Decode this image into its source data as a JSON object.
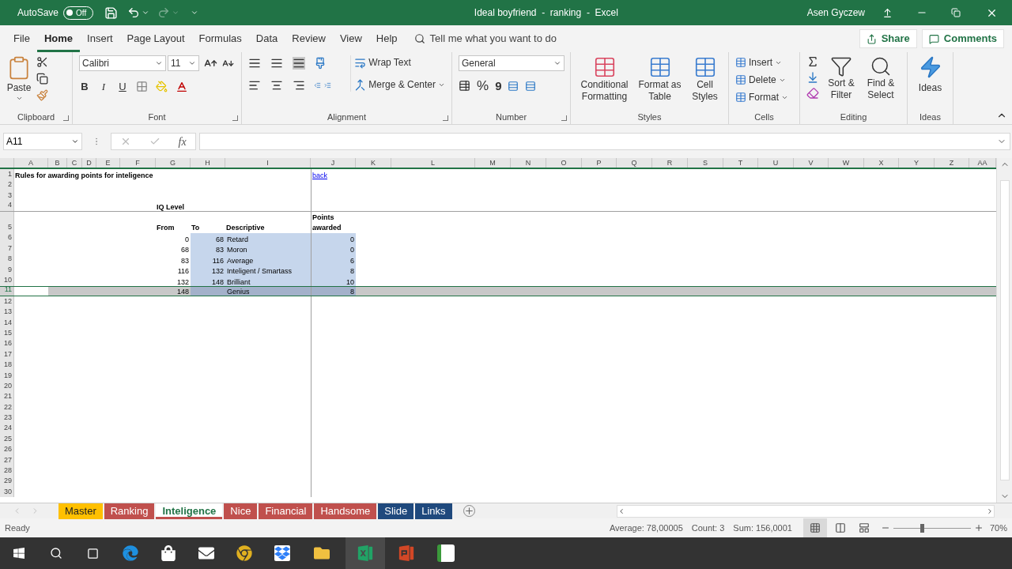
{
  "title_bar": {
    "autosave_label": "AutoSave",
    "autosave_state": "Off",
    "autosave_on": false,
    "document_title": "Ideal boyfriend  -  ranking  -  Excel",
    "user": "Asen Gyczew"
  },
  "menu_tabs": [
    {
      "label": "File",
      "selected": false
    },
    {
      "label": "Home",
      "selected": true
    },
    {
      "label": "Insert",
      "selected": false
    },
    {
      "label": "Page Layout",
      "selected": false
    },
    {
      "label": "Formulas",
      "selected": false
    },
    {
      "label": "Data",
      "selected": false
    },
    {
      "label": "Review",
      "selected": false
    },
    {
      "label": "View",
      "selected": false
    },
    {
      "label": "Help",
      "selected": false
    }
  ],
  "tell_me": {
    "placeholder": "Tell me what you want to do"
  },
  "share": "Share",
  "comments": "Comments",
  "ribbon": {
    "clipboard": {
      "label": "Clipboard",
      "paste": "Paste"
    },
    "font": {
      "label": "Font",
      "font_name": "Calibri",
      "font_size": "11",
      "bold": "B",
      "italic": "I",
      "underline": "U"
    },
    "alignment": {
      "label": "Alignment",
      "wrap_text": "Wrap Text",
      "merge_center": "Merge & Center"
    },
    "number": {
      "label": "Number",
      "format": "General",
      "percent": "%",
      "comma": "9"
    },
    "styles": {
      "label": "Styles",
      "buttons": [
        "Conditional Formatting",
        "Format as Table",
        "Cell Styles"
      ]
    },
    "cells": {
      "label": "Cells",
      "buttons": [
        "Insert",
        "Delete",
        "Format"
      ]
    },
    "editing": {
      "label": "Editing",
      "buttons": [
        "Sort & Filter",
        "Find & Select"
      ]
    },
    "ideas": {
      "label": "Ideas",
      "button": "Ideas"
    }
  },
  "formula_bar": {
    "name_box": "A11",
    "function_symbol": "fx"
  },
  "columns": [
    "A",
    "B",
    "C",
    "D",
    "E",
    "F",
    "G",
    "H",
    "I",
    "J",
    "K",
    "L",
    "M",
    "N",
    "O",
    "P",
    "Q",
    "R",
    "S",
    "T",
    "U",
    "V",
    "W",
    "X",
    "Y",
    "Z",
    "AA"
  ],
  "row_numbers": [
    "1",
    "2",
    "3",
    "4",
    "5",
    "6",
    "7",
    "8",
    "9",
    "10",
    "11",
    "12",
    "13",
    "14",
    "15",
    "16",
    "17",
    "18",
    "19",
    "20",
    "21",
    "22",
    "23",
    "24",
    "25",
    "26",
    "27",
    "28",
    "29",
    "30"
  ],
  "sheet": {
    "title": "Rules for awarding points for inteligence",
    "link": "back",
    "group_header": "IQ Level",
    "headers": [
      "From",
      "To",
      "Descriptive",
      "Points awarded"
    ],
    "rows": [
      {
        "from": "0",
        "to": "68",
        "descriptive": "Retard",
        "points": "0",
        "highlighted": true,
        "selected": false
      },
      {
        "from": "68",
        "to": "83",
        "descriptive": "Moron",
        "points": "0",
        "highlighted": true,
        "selected": false
      },
      {
        "from": "83",
        "to": "116",
        "descriptive": "Average",
        "points": "6",
        "highlighted": true,
        "selected": false
      },
      {
        "from": "116",
        "to": "132",
        "descriptive": "Inteligent / Smartass",
        "points": "8",
        "highlighted": true,
        "selected": false
      },
      {
        "from": "132",
        "to": "148",
        "descriptive": "Brilliant",
        "points": "10",
        "highlighted": true,
        "selected": false
      },
      {
        "from": "148",
        "descriptive": "Genius",
        "points": "8",
        "highlighted": true,
        "selected": true
      }
    ]
  },
  "sheet_tabs": [
    {
      "label": "Master",
      "color": "#ffc000",
      "selected": false
    },
    {
      "label": "Ranking",
      "color": "#c0504d",
      "selected": false
    },
    {
      "label": "Inteligence",
      "color": "#c0504d",
      "selected": true
    },
    {
      "label": "Nice",
      "color": "#c0504d",
      "selected": false
    },
    {
      "label": "Financial",
      "color": "#c0504d",
      "selected": false
    },
    {
      "label": "Handsome",
      "color": "#c0504d",
      "selected": false
    },
    {
      "label": "Slide",
      "color": "#1f497d",
      "selected": false
    },
    {
      "label": "Links",
      "color": "#1f497d",
      "selected": false
    }
  ],
  "status_bar": {
    "mode": "Ready",
    "average": "Average: 78,00005",
    "count": "Count: 3",
    "sum": "Sum: 156,0001",
    "zoom": "70%",
    "level": 0.35
  }
}
